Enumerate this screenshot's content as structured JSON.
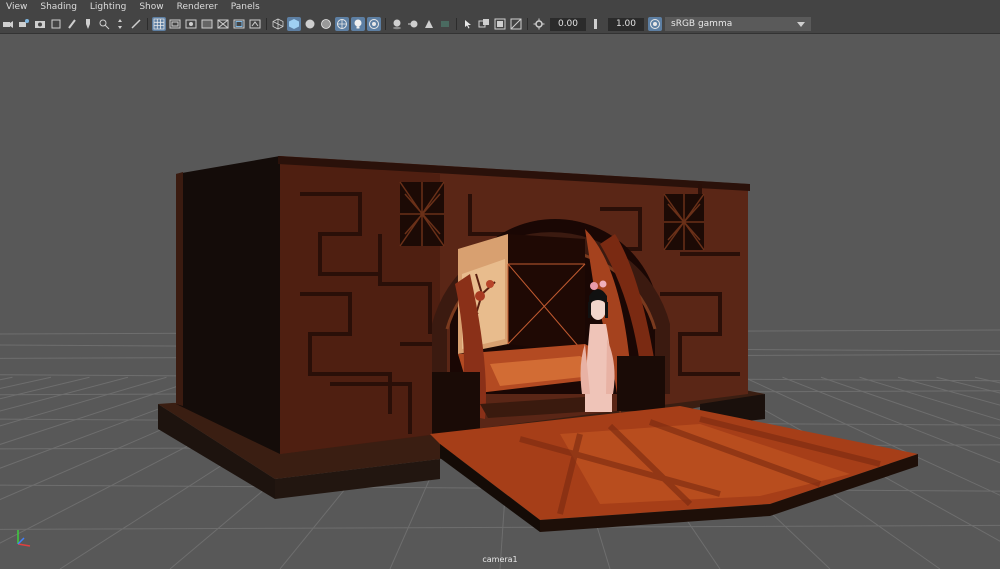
{
  "menubar": {
    "items": [
      {
        "label": "View"
      },
      {
        "label": "Shading"
      },
      {
        "label": "Lighting"
      },
      {
        "label": "Show"
      },
      {
        "label": "Renderer"
      },
      {
        "label": "Panels"
      }
    ]
  },
  "toolbar": {
    "exposure_value": "0.00",
    "gamma_value": "1.00",
    "color_space": "sRGB gamma",
    "active_color": "#5d7fa3"
  },
  "viewport": {
    "camera_label": "camera1",
    "background_color": "#585858",
    "grid_color": "#6e6e6e"
  }
}
